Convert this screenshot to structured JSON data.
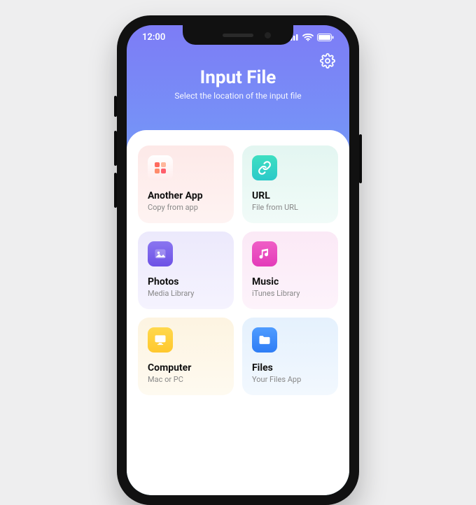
{
  "status": {
    "time": "12:00"
  },
  "header": {
    "title": "Input File",
    "subtitle": "Select the location of the input file"
  },
  "cards": {
    "app": {
      "title": "Another App",
      "sub": "Copy from app"
    },
    "url": {
      "title": "URL",
      "sub": "File from URL"
    },
    "photos": {
      "title": "Photos",
      "sub": "Media Library"
    },
    "music": {
      "title": "Music",
      "sub": "iTunes Library"
    },
    "computer": {
      "title": "Computer",
      "sub": "Mac or PC"
    },
    "files": {
      "title": "Files",
      "sub": "Your Files App"
    }
  }
}
